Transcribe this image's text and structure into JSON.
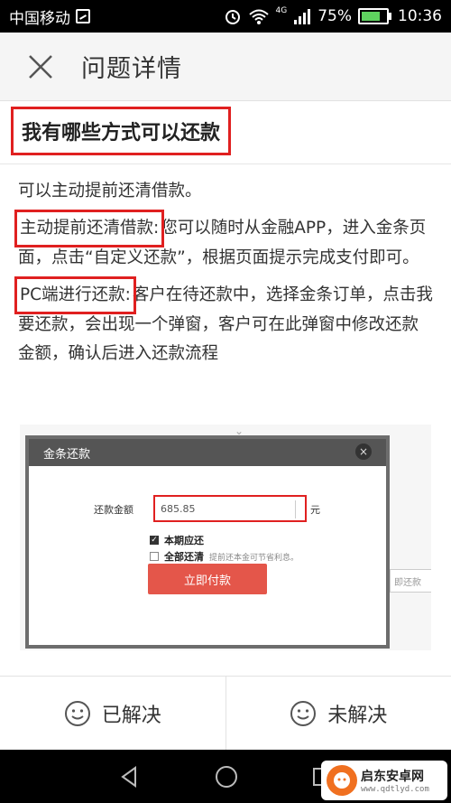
{
  "status_bar": {
    "carrier": "中国移动",
    "network": "4G",
    "battery": "75%",
    "battery_level": 0.75,
    "time": "10:36"
  },
  "header": {
    "title": "问题详情",
    "close_icon": "close-icon"
  },
  "question": {
    "title": "我有哪些方式可以还款"
  },
  "answer": {
    "intro": "可以主动提前还清借款。",
    "method1_label": "主动提前还清借款:",
    "method1_text": "您可以随时从金融APP，进入金条页面，点击“自定义还款”，根据页面提示完成支付即可。",
    "method2_label": "PC端进行还款:",
    "method2_text": "客户在待还款中，选择金条订单，点击我要还款，会出现一个弹窗，客户可在此弹窗中修改还款金额，确认后进入还款流程"
  },
  "screenshot": {
    "dialog_title": "金条还款",
    "close_glyph": "×",
    "amount_label": "还款金额",
    "amount_value": "685.85",
    "unit": "元",
    "option1": "本期应还",
    "option2": "全部还清",
    "option2_note": "提前还本金可节省利息。",
    "pay_button": "立即付款",
    "bg_button": "即还款"
  },
  "feedback": {
    "solved": "已解决",
    "unsolved": "未解决",
    "icon": "smiley-icon"
  },
  "watermark": {
    "name": "启东安卓网",
    "url": "www.qdtlyd.com"
  },
  "colors": {
    "highlight": "#e02020",
    "pay_button": "#e4564a",
    "header_bg": "#f5f5f5"
  }
}
